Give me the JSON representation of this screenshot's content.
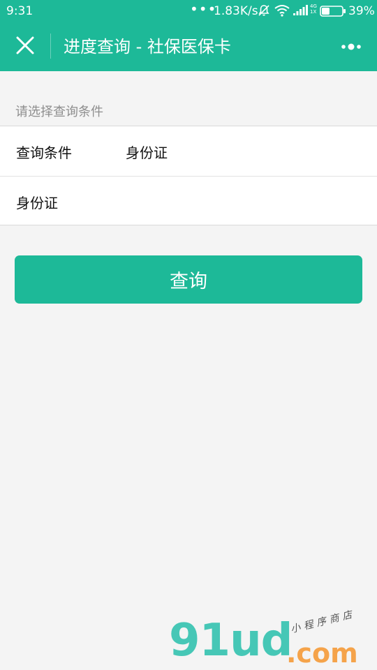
{
  "status_bar": {
    "time": "9:31",
    "more_dots": "•••",
    "network_speed": "1.83K/s",
    "network_tag_top": "4G",
    "network_tag_bottom": "1X",
    "battery_percent": "39%",
    "battery_level": 0.39,
    "icons": [
      "silent-bell-icon",
      "wifi-icon",
      "signal-icon",
      "battery-icon"
    ]
  },
  "nav": {
    "title": "进度查询 - 社保医保卡",
    "icons": [
      "close-icon",
      "more-menu-icon"
    ]
  },
  "form": {
    "section_hint": "请选择查询条件",
    "condition_label": "查询条件",
    "condition_value": "身份证",
    "id_label": "身份证",
    "id_value": ""
  },
  "actions": {
    "query_button_label": "查询"
  },
  "watermark": {
    "logo_text": "91ud",
    "logo_suffix": ".com",
    "tagline": "小程序商店"
  },
  "colors": {
    "accent": "#1db998",
    "background": "#f4f4f4",
    "watermark_teal": "#46c7b6",
    "watermark_orange": "#f5a34a"
  }
}
